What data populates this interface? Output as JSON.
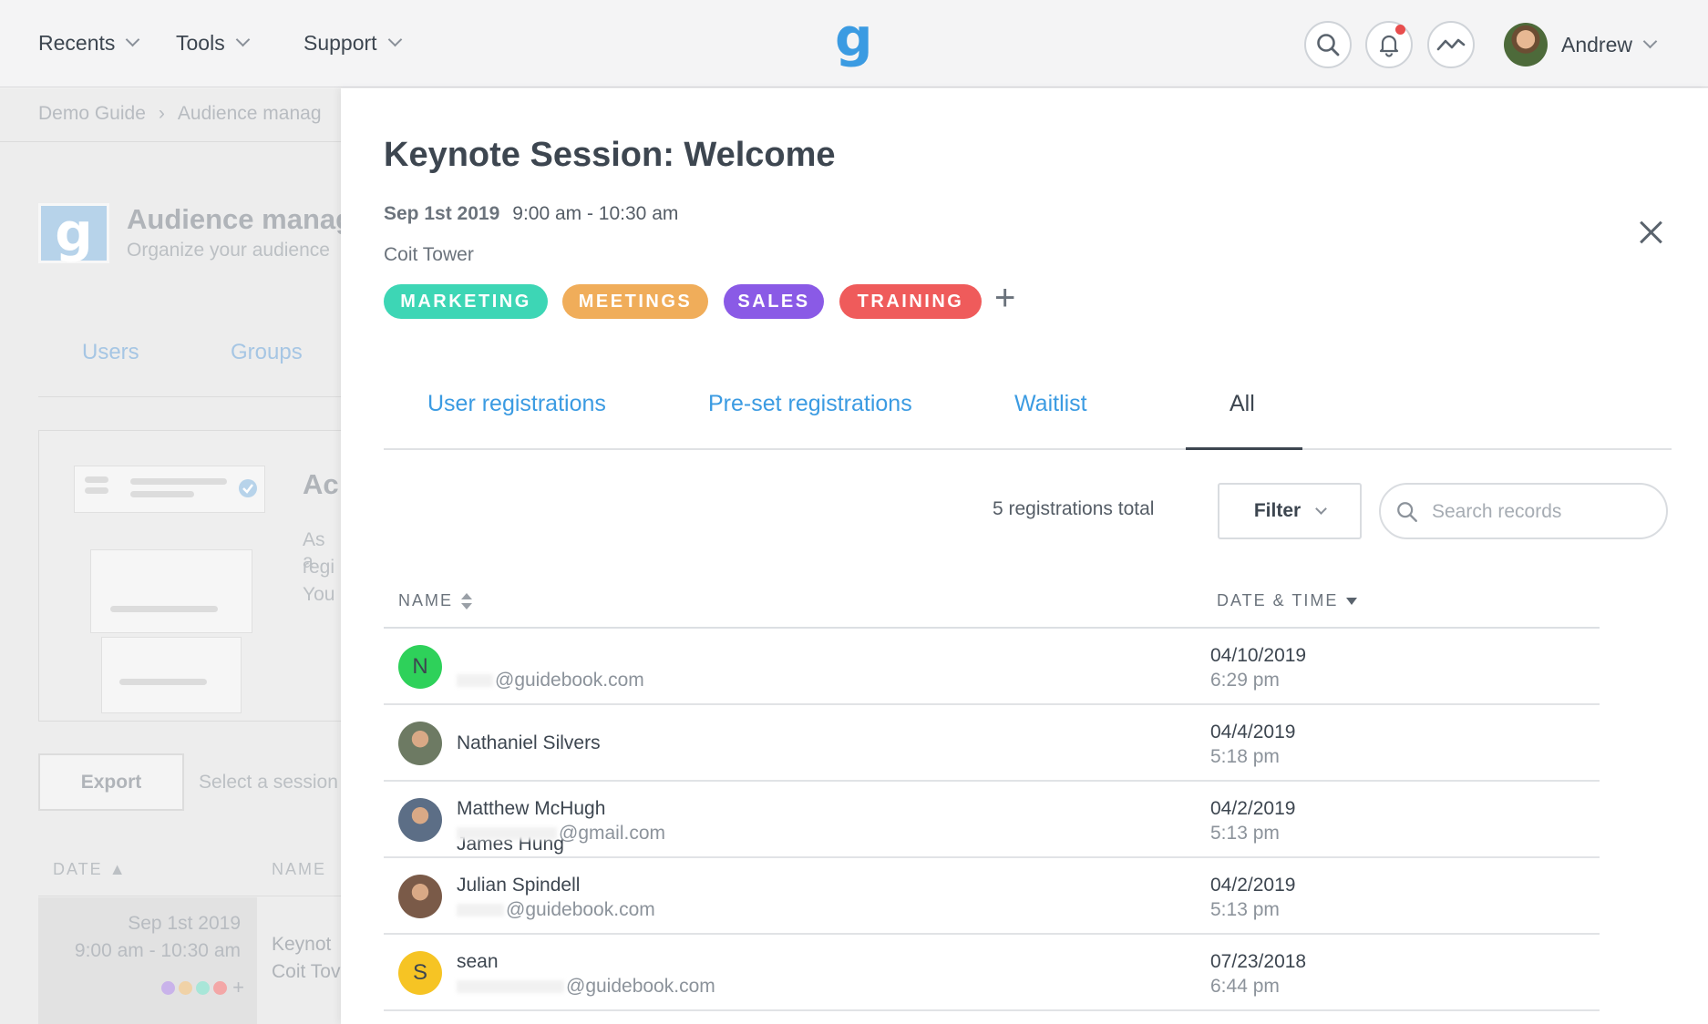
{
  "topnav": {
    "recents": "Recents",
    "tools": "Tools",
    "support": "Support",
    "logo": "g",
    "user_name": "Andrew"
  },
  "background": {
    "breadcrumb": [
      "Demo Guide",
      "Audience manag"
    ],
    "logo": "g",
    "title": "Audience manag",
    "subtitle": "Organize your audience",
    "tabs": [
      "Users",
      "Groups"
    ],
    "card_heading": "Ac",
    "card_lines": [
      "As a",
      "regi",
      "You"
    ],
    "export_label": "Export",
    "select_hint": "Select a session",
    "col_date": "DATE",
    "col_name": "NAME",
    "row_date": "Sep 1st 2019",
    "row_time": "9:00 am - 10:30 am",
    "row_title": "Keynot",
    "row_loc": "Coit Tov",
    "row_dot_colors": [
      "#c9b3ea",
      "#f0d2a7",
      "#a8e6d8",
      "#f3a7a7"
    ]
  },
  "panel": {
    "title": "Keynote Session: Welcome",
    "date": "Sep 1st 2019",
    "time": "9:00 am - 10:30 am",
    "location": "Coit Tower",
    "tags": [
      {
        "label": "MARKETING",
        "color": "#3dd6b5"
      },
      {
        "label": "MEETINGS",
        "color": "#f0ad5a"
      },
      {
        "label": "SALES",
        "color": "#8a5ae6"
      },
      {
        "label": "TRAINING",
        "color": "#ef5b5b"
      }
    ],
    "tabs": [
      "User registrations",
      "Pre-set registrations",
      "Waitlist",
      "All"
    ],
    "active_tab": "All",
    "registrations_total": "5 registrations total",
    "filter_label": "Filter",
    "search_placeholder": "Search records",
    "col_name": "NAME",
    "col_datetime": "DATE & TIME",
    "rows": [
      {
        "initial": "N",
        "avatar_color": "#2ed15a",
        "name": "Nathaniel Silvers",
        "email": "@guidebook.com",
        "date": "04/10/2019",
        "time": "6:29 pm"
      },
      {
        "initial": "",
        "avatar_color": "#6d7a63",
        "name": "James Hung",
        "email": "",
        "date": "04/4/2019",
        "time": "5:18 pm"
      },
      {
        "initial": "",
        "avatar_color": "#5c6e86",
        "name": "Matthew McHugh",
        "email": "@gmail.com",
        "date": "04/2/2019",
        "time": "5:13 pm"
      },
      {
        "initial": "",
        "avatar_color": "#7a5a48",
        "name": "Julian Spindell",
        "email": "@guidebook.com",
        "date": "04/2/2019",
        "time": "5:13 pm"
      },
      {
        "initial": "S",
        "avatar_color": "#f6c424",
        "name": "sean",
        "email": "@guidebook.com",
        "date": "07/23/2018",
        "time": "6:44 pm"
      }
    ]
  }
}
